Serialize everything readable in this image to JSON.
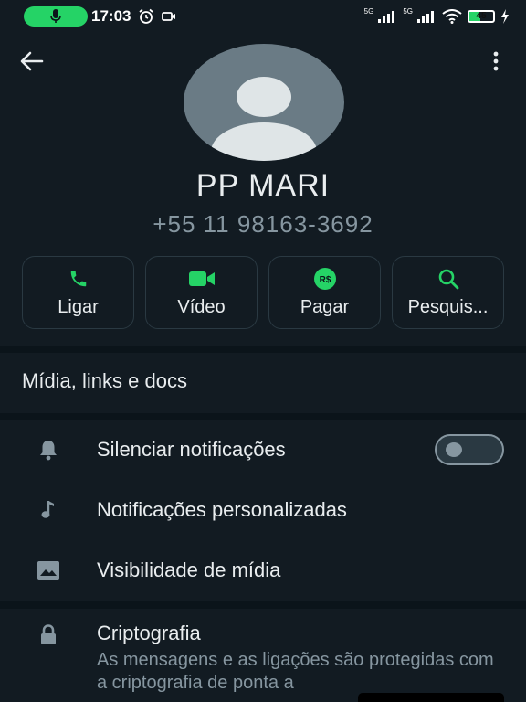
{
  "status_bar": {
    "time": "17:03",
    "network_1": "5G",
    "network_2": "5G",
    "battery_level": "45",
    "icons": [
      "mic-icon",
      "alarm-icon",
      "screen-record-icon",
      "signal-icon",
      "wifi-icon",
      "battery-icon",
      "charging-icon"
    ]
  },
  "header": {
    "back_icon": "arrow-left-icon",
    "menu_icon": "more-vert-icon"
  },
  "contact": {
    "name": "PP MARI",
    "phone": "+55 11 98163-3692"
  },
  "actions": [
    {
      "label": "Ligar",
      "icon": "phone-icon"
    },
    {
      "label": "Vídeo",
      "icon": "video-icon"
    },
    {
      "label": "Pagar",
      "icon": "payment-icon",
      "icon_text": "R$"
    },
    {
      "label": "Pesquis...",
      "icon": "search-icon"
    }
  ],
  "media_section": {
    "title": "Mídia, links e docs"
  },
  "settings": [
    {
      "label": "Silenciar notificações",
      "icon": "bell-icon",
      "toggle": false
    },
    {
      "label": "Notificações personalizadas",
      "icon": "music-note-icon"
    },
    {
      "label": "Visibilidade de mídia",
      "icon": "image-icon"
    }
  ],
  "encryption": {
    "title": "Criptografia",
    "description": "As mensagens e as ligações são protegidas com a criptografia de ponta a"
  },
  "colors": {
    "background": "#121b22",
    "accent": "#25d366",
    "text_primary": "#e9edef",
    "text_secondary": "#8696a0"
  }
}
